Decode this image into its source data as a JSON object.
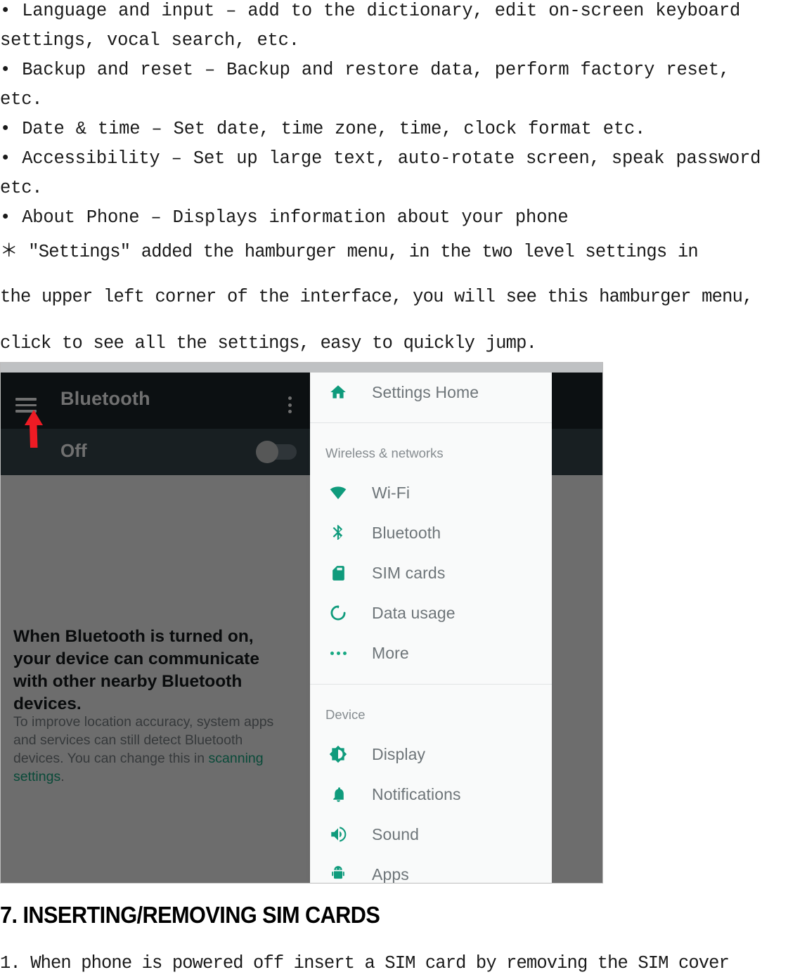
{
  "document": {
    "bullets_block_1": "• Language and input – add to the dictionary, edit on-screen keyboard\nsettings, vocal search, etc.\n• Backup and reset – Backup and restore data, perform factory reset,\netc.\n• Date & time – Set date, time zone, time, clock format etc.\n• Accessibility – Set up large text, auto-rotate screen, speak password\netc.\n• About Phone – Displays information about your phone",
    "note_line_1": "＊ \"Settings\" added the hamburger menu, in the two level settings in",
    "note_line_2": "the upper left corner of the interface, you will see this hamburger menu,",
    "note_line_3": "click to see all the settings, easy to quickly jump.",
    "section_heading": "7. INSERTING/REMOVING SIM CARDS",
    "footer_line": "1. When phone is powered off insert a SIM card by removing the SIM cover"
  },
  "screenshot": {
    "bluetooth_screen": {
      "app_bar_title": "Bluetooth",
      "menu_icon": "hamburger-menu-icon",
      "overflow_icon": "overflow-menu-icon",
      "switch_label": "Off",
      "switch_state": "off",
      "headline": "When Bluetooth is turned on, your device can communicate with other nearby Bluetooth devices.",
      "subtext_prefix": "To improve location accuracy, system apps and services can still detect Bluetooth devices. You can change this in ",
      "subtext_link": "scanning settings",
      "subtext_suffix": ".",
      "colors": {
        "app_bar": "#1d262b",
        "switch_bar": "#37474f",
        "body": "#f7f8f8",
        "link": "#17a882"
      }
    },
    "drawer": {
      "home_item": {
        "label": "Settings Home",
        "icon": "home-icon"
      },
      "group_wireless": "Wireless & networks",
      "wireless_items": [
        {
          "label": "Wi-Fi",
          "icon": "wifi-icon"
        },
        {
          "label": "Bluetooth",
          "icon": "bluetooth-icon"
        },
        {
          "label": "SIM cards",
          "icon": "sim-card-icon"
        },
        {
          "label": "Data usage",
          "icon": "data-usage-icon"
        },
        {
          "label": "More",
          "icon": "more-dots-icon"
        }
      ],
      "group_device": "Device",
      "device_items": [
        {
          "label": "Display",
          "icon": "brightness-icon"
        },
        {
          "label": "Notifications",
          "icon": "bell-icon"
        },
        {
          "label": "Sound",
          "icon": "volume-icon"
        },
        {
          "label": "Apps",
          "icon": "android-robot-icon"
        }
      ],
      "accent_color": "#17a882"
    },
    "annotation": {
      "arrow_color": "#ee1b24",
      "arrow_points_to": "hamburger-menu-icon"
    }
  }
}
